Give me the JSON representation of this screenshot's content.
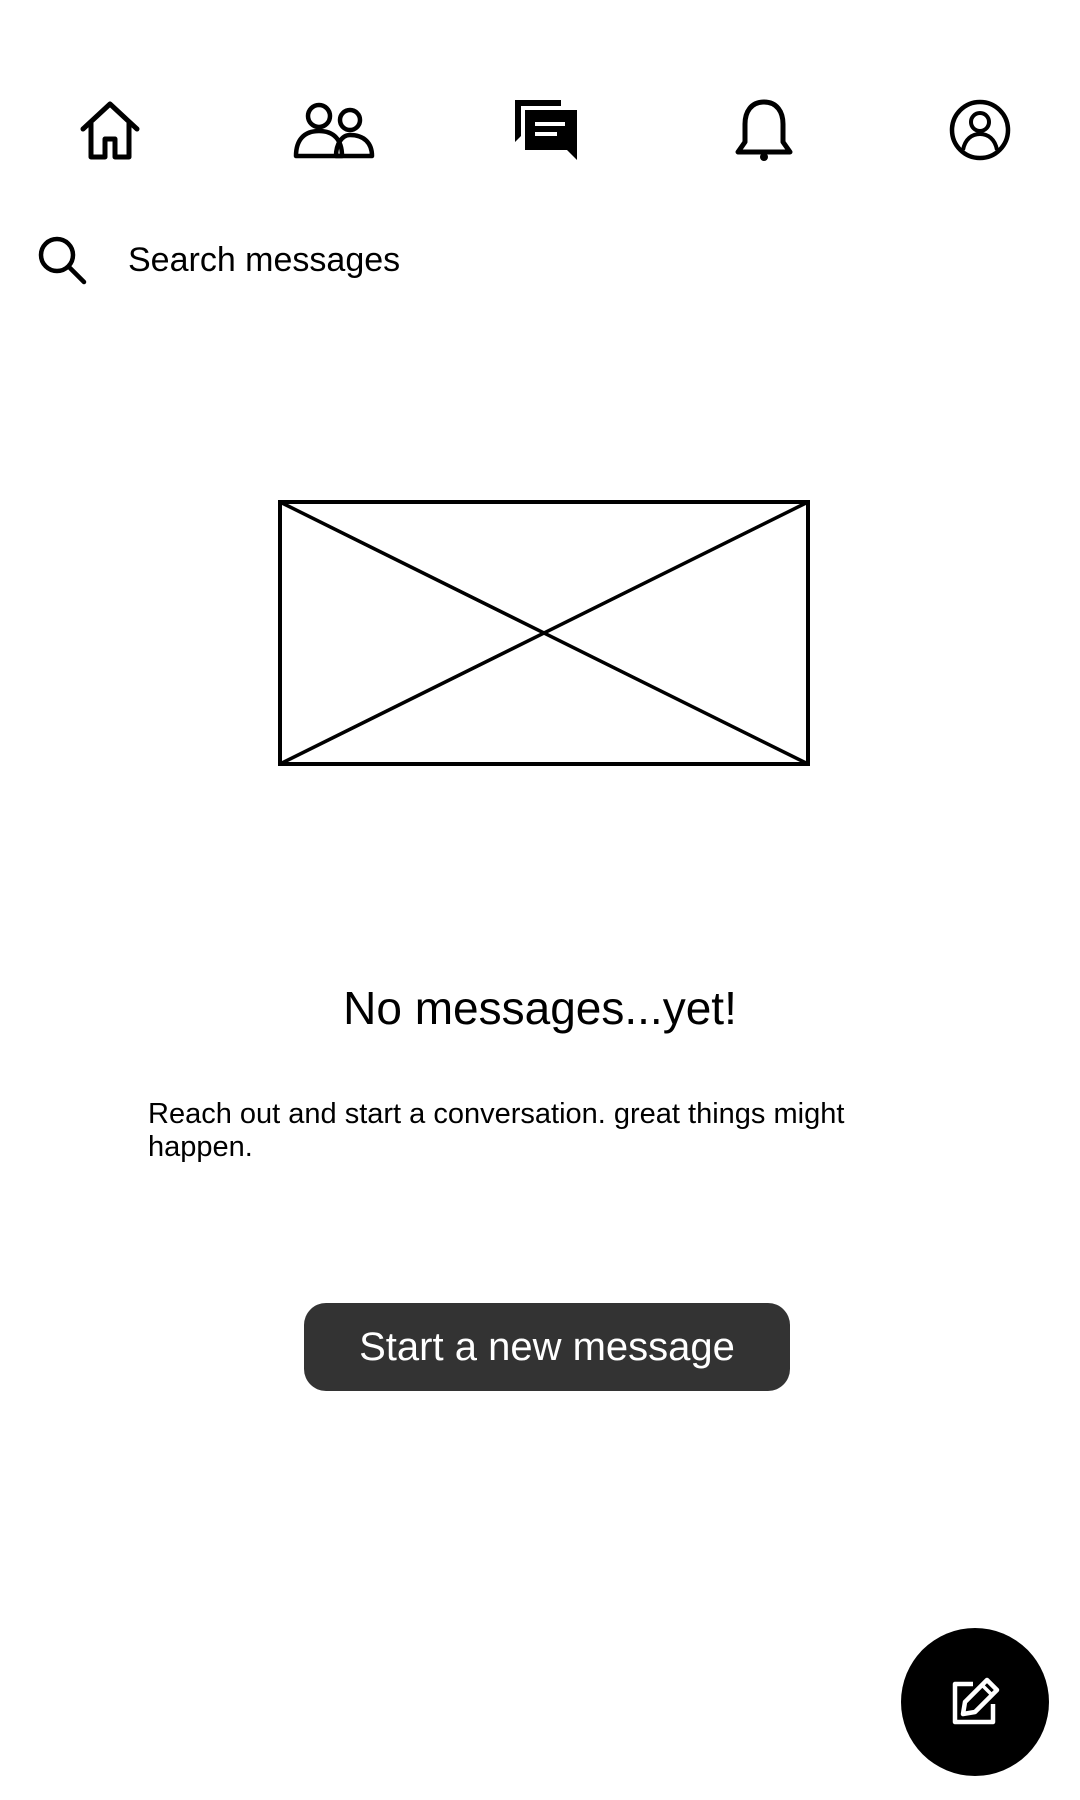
{
  "nav": {
    "items": [
      {
        "icon": "home-icon",
        "label": ""
      },
      {
        "icon": "people-icon",
        "label": ""
      },
      {
        "icon": "messages-icon",
        "label": ""
      },
      {
        "icon": "bell-icon",
        "label": ""
      },
      {
        "icon": "profile-icon",
        "label": ""
      }
    ],
    "active": "messages-icon"
  },
  "search": {
    "icon": "search-icon",
    "placeholder": "Search messages",
    "value": ""
  },
  "empty_state": {
    "image_icon": "image-placeholder-icon",
    "title": "No messages...yet!",
    "description": "Reach out and start a conversation. great things might happen."
  },
  "actions": {
    "start_label": "Start a new message",
    "fab_icon": "compose-icon"
  },
  "colors": {
    "button_bg": "#333333",
    "fab_bg": "#000000",
    "text": "#000000"
  }
}
